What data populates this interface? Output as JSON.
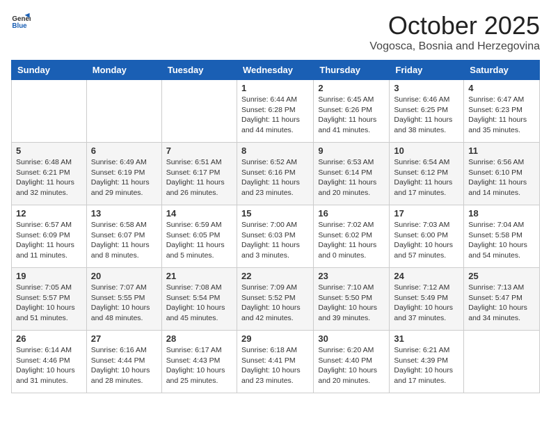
{
  "header": {
    "logo_general": "General",
    "logo_blue": "Blue",
    "month": "October 2025",
    "location": "Vogosca, Bosnia and Herzegovina"
  },
  "weekdays": [
    "Sunday",
    "Monday",
    "Tuesday",
    "Wednesday",
    "Thursday",
    "Friday",
    "Saturday"
  ],
  "weeks": [
    [
      {
        "day": "",
        "info": ""
      },
      {
        "day": "",
        "info": ""
      },
      {
        "day": "",
        "info": ""
      },
      {
        "day": "1",
        "info": "Sunrise: 6:44 AM\nSunset: 6:28 PM\nDaylight: 11 hours\nand 44 minutes."
      },
      {
        "day": "2",
        "info": "Sunrise: 6:45 AM\nSunset: 6:26 PM\nDaylight: 11 hours\nand 41 minutes."
      },
      {
        "day": "3",
        "info": "Sunrise: 6:46 AM\nSunset: 6:25 PM\nDaylight: 11 hours\nand 38 minutes."
      },
      {
        "day": "4",
        "info": "Sunrise: 6:47 AM\nSunset: 6:23 PM\nDaylight: 11 hours\nand 35 minutes."
      }
    ],
    [
      {
        "day": "5",
        "info": "Sunrise: 6:48 AM\nSunset: 6:21 PM\nDaylight: 11 hours\nand 32 minutes."
      },
      {
        "day": "6",
        "info": "Sunrise: 6:49 AM\nSunset: 6:19 PM\nDaylight: 11 hours\nand 29 minutes."
      },
      {
        "day": "7",
        "info": "Sunrise: 6:51 AM\nSunset: 6:17 PM\nDaylight: 11 hours\nand 26 minutes."
      },
      {
        "day": "8",
        "info": "Sunrise: 6:52 AM\nSunset: 6:16 PM\nDaylight: 11 hours\nand 23 minutes."
      },
      {
        "day": "9",
        "info": "Sunrise: 6:53 AM\nSunset: 6:14 PM\nDaylight: 11 hours\nand 20 minutes."
      },
      {
        "day": "10",
        "info": "Sunrise: 6:54 AM\nSunset: 6:12 PM\nDaylight: 11 hours\nand 17 minutes."
      },
      {
        "day": "11",
        "info": "Sunrise: 6:56 AM\nSunset: 6:10 PM\nDaylight: 11 hours\nand 14 minutes."
      }
    ],
    [
      {
        "day": "12",
        "info": "Sunrise: 6:57 AM\nSunset: 6:09 PM\nDaylight: 11 hours\nand 11 minutes."
      },
      {
        "day": "13",
        "info": "Sunrise: 6:58 AM\nSunset: 6:07 PM\nDaylight: 11 hours\nand 8 minutes."
      },
      {
        "day": "14",
        "info": "Sunrise: 6:59 AM\nSunset: 6:05 PM\nDaylight: 11 hours\nand 5 minutes."
      },
      {
        "day": "15",
        "info": "Sunrise: 7:00 AM\nSunset: 6:03 PM\nDaylight: 11 hours\nand 3 minutes."
      },
      {
        "day": "16",
        "info": "Sunrise: 7:02 AM\nSunset: 6:02 PM\nDaylight: 11 hours\nand 0 minutes."
      },
      {
        "day": "17",
        "info": "Sunrise: 7:03 AM\nSunset: 6:00 PM\nDaylight: 10 hours\nand 57 minutes."
      },
      {
        "day": "18",
        "info": "Sunrise: 7:04 AM\nSunset: 5:58 PM\nDaylight: 10 hours\nand 54 minutes."
      }
    ],
    [
      {
        "day": "19",
        "info": "Sunrise: 7:05 AM\nSunset: 5:57 PM\nDaylight: 10 hours\nand 51 minutes."
      },
      {
        "day": "20",
        "info": "Sunrise: 7:07 AM\nSunset: 5:55 PM\nDaylight: 10 hours\nand 48 minutes."
      },
      {
        "day": "21",
        "info": "Sunrise: 7:08 AM\nSunset: 5:54 PM\nDaylight: 10 hours\nand 45 minutes."
      },
      {
        "day": "22",
        "info": "Sunrise: 7:09 AM\nSunset: 5:52 PM\nDaylight: 10 hours\nand 42 minutes."
      },
      {
        "day": "23",
        "info": "Sunrise: 7:10 AM\nSunset: 5:50 PM\nDaylight: 10 hours\nand 39 minutes."
      },
      {
        "day": "24",
        "info": "Sunrise: 7:12 AM\nSunset: 5:49 PM\nDaylight: 10 hours\nand 37 minutes."
      },
      {
        "day": "25",
        "info": "Sunrise: 7:13 AM\nSunset: 5:47 PM\nDaylight: 10 hours\nand 34 minutes."
      }
    ],
    [
      {
        "day": "26",
        "info": "Sunrise: 6:14 AM\nSunset: 4:46 PM\nDaylight: 10 hours\nand 31 minutes."
      },
      {
        "day": "27",
        "info": "Sunrise: 6:16 AM\nSunset: 4:44 PM\nDaylight: 10 hours\nand 28 minutes."
      },
      {
        "day": "28",
        "info": "Sunrise: 6:17 AM\nSunset: 4:43 PM\nDaylight: 10 hours\nand 25 minutes."
      },
      {
        "day": "29",
        "info": "Sunrise: 6:18 AM\nSunset: 4:41 PM\nDaylight: 10 hours\nand 23 minutes."
      },
      {
        "day": "30",
        "info": "Sunrise: 6:20 AM\nSunset: 4:40 PM\nDaylight: 10 hours\nand 20 minutes."
      },
      {
        "day": "31",
        "info": "Sunrise: 6:21 AM\nSunset: 4:39 PM\nDaylight: 10 hours\nand 17 minutes."
      },
      {
        "day": "",
        "info": ""
      }
    ]
  ]
}
